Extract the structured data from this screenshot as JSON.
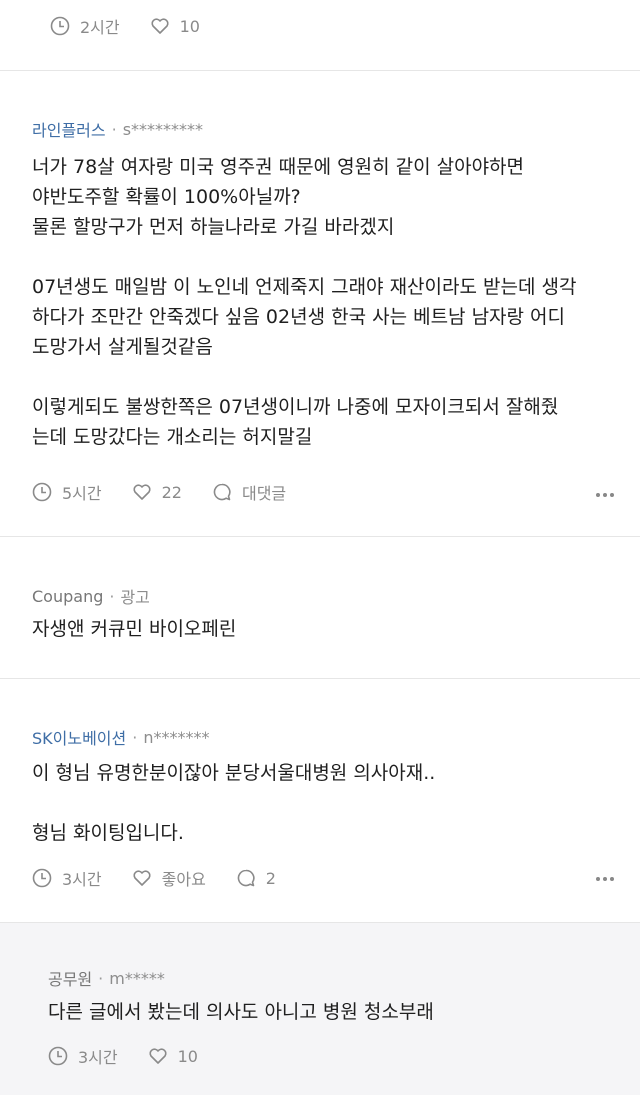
{
  "top_comment": {
    "time": "2시간",
    "likes": "10"
  },
  "comment1": {
    "author": "라인플러스",
    "separator": "·",
    "userid": "s*********",
    "lines": [
      "너가 78살 여자랑 미국 영주권 때문에 영원히 같이 살아야하면",
      "야반도주할 확률이 100%아닐까?",
      "물론 할망구가 먼저 하늘나라로 가길 바라겠지",
      "07년생도 매일밤 이 노인네 언제죽지 그래야 재산이라도 받는데 생각",
      "하다가 조만간 안죽겠다 싶음 02년생 한국 사는 베트남 남자랑 어디",
      "도망가서 살게될것같음",
      "이렇게되도 불쌍한쪽은 07년생이니까 나중에 모자이크되서 잘해줬",
      "는데 도망갔다는 개소리는 허지말길"
    ],
    "time": "5시간",
    "likes": "22",
    "reply_label": "대댓글"
  },
  "ad": {
    "advertiser": "Coupang",
    "separator": "·",
    "ad_label": "광고",
    "text": "자생앤 커큐민 바이오페린"
  },
  "comment2": {
    "author": "SK이노베이션",
    "separator": "·",
    "userid": "n*******",
    "lines": [
      "이 형님 유명한분이잖아 분당서울대병원 의사아재..",
      "형님 화이팅입니다."
    ],
    "time": "3시간",
    "likes": "좋아요",
    "replies": "2"
  },
  "reply1": {
    "author": "공무원",
    "separator": "·",
    "userid": "m*****",
    "text": "다른 글에서 봤는데 의사도 아니고 병원 청소부래",
    "time": "3시간",
    "likes": "10"
  },
  "colors": {
    "author_link": "#3f6ea6",
    "meta_gray": "#8a8a8a",
    "reply_background": "#f5f5f7"
  },
  "icons": [
    "clock-icon",
    "heart-icon",
    "comment-bubble-icon",
    "more-dots-icon"
  ]
}
